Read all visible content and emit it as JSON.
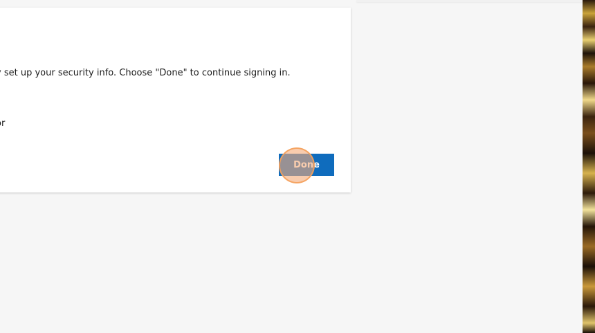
{
  "dialog": {
    "message": "y set up your security info. Choose \"Done\" to continue signing in.",
    "partial_line": "or",
    "done_label": "Done"
  },
  "colors": {
    "page_background": "#f6f6f6",
    "card_background": "#ffffff",
    "primary_button": "#0f6cbd",
    "click_marker": "#f3aa78"
  }
}
